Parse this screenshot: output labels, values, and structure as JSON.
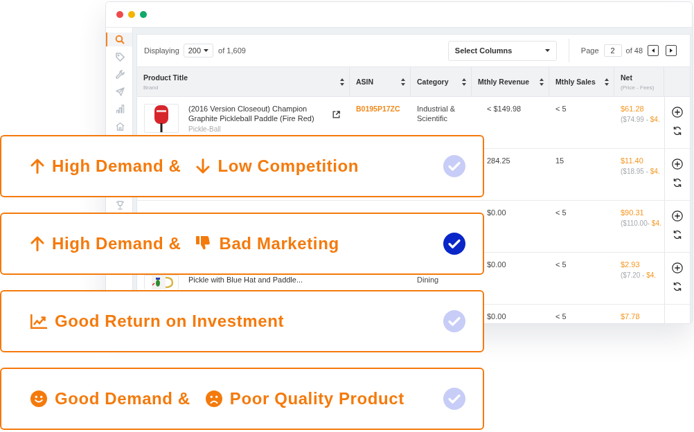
{
  "sidebar": {
    "items": [
      {
        "selected": true
      },
      {
        "selected": false
      },
      {
        "selected": false
      },
      {
        "selected": false
      },
      {
        "selected": false
      },
      {
        "selected": false
      },
      {
        "selected": false
      }
    ]
  },
  "toolbar": {
    "label": "Displaying",
    "page_size": "200",
    "total": "of 1,609",
    "columns_select": "Select Columns",
    "page_label": "Page",
    "page": "2",
    "page_count": "of 48"
  },
  "table": {
    "columns": [
      {
        "label": "Product Title",
        "sublabel": "Brand",
        "sortable": true
      },
      {
        "label": "ASIN",
        "sortable": true
      },
      {
        "label": "Category",
        "sortable": true
      },
      {
        "label": "Mthly Revenue",
        "sortable": true
      },
      {
        "label": "Mthly Sales",
        "sortable": true
      },
      {
        "label": "Net",
        "sublabel": "(Price - Fees)",
        "sortable": false
      }
    ],
    "rows": [
      {
        "title": "(2016 Version Closeout) Champion Graphite Pickleball Paddle (Fire Red)",
        "brand": "Pickle-Ball",
        "asin": "B0195P17ZC",
        "category": "Industrial & Scientific",
        "revenue": "< $149.98",
        "sales": "< 5",
        "net": "$61.28",
        "net_price": "($74.99 -",
        "net_fees": "$4."
      },
      {
        "revenue": "284.25",
        "sales": "15",
        "net": "$11.40",
        "net_price": "($18.95 -",
        "net_fees": "$4."
      },
      {
        "revenue": "$0.00",
        "sales": "< 5",
        "net": "$90.31",
        "net_price": "($110.00-",
        "net_fees": "$4."
      },
      {
        "title": "Pickle with Blue Hat and Paddle...",
        "category": "Dining",
        "revenue": "$0.00",
        "sales": "< 5",
        "net": "$2.93",
        "net_price": "($7.20 -",
        "net_fees": "$4."
      },
      {
        "revenue": "$0.00",
        "sales": "< 5",
        "net": "$7.78"
      }
    ]
  },
  "filters": [
    {
      "segments": [
        {
          "text": "High Demand &"
        },
        {
          "text": "Low Competition"
        }
      ],
      "selected": false
    },
    {
      "segments": [
        {
          "text": "High Demand &"
        },
        {
          "text": "Bad Marketing"
        }
      ],
      "selected": true
    },
    {
      "segments": [
        {
          "text": "Good Return on Investment"
        }
      ],
      "selected": false
    },
    {
      "segments": [
        {
          "text": "Good Demand &"
        },
        {
          "text": "Poor Quality Product"
        }
      ],
      "selected": false
    }
  ]
}
